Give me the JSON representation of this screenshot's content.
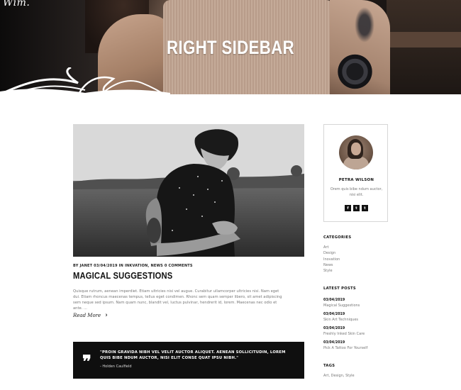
{
  "header": {
    "logo_text": "Wim.",
    "page_title": "RIGHT SIDEBAR"
  },
  "post": {
    "meta": "BY JANET 03/04/2019 IN INKVATION, NEWS 0 COMMENTS",
    "title": "MAGICAL SUGGESTIONS",
    "excerpt": "Quisque rutrum, aenean imperdiet. Etiam ultricies nisi vel augue. Curabitur ullamcorper ultricies nisi. Nam eget dui. Etiam rhoncus maecenas tempus, tellus eget condimen. Rhonc sem quam semper libero, sit amet adipiscing sem neque sed ipsum. Nam quam nunc, blandit vel, luctus pulvinar, hendrerit id, lorem. Maecenas nec odio et ante. ...",
    "read_more": "Read More"
  },
  "quote": {
    "text": "\"PROIN GRAVIDA NIBH VEL VELIT AUCTOR ALIQUET. AENEAN SOLLICITUDIN, LOREM QUIS BIBE NDUM AUCTOR, NISI ELIT CONSE QUAT IPSU NIBH.\"",
    "author": "- Holden Caulfield"
  },
  "sidebar": {
    "author": {
      "name": "PETRA WILSON",
      "bio": "Orem quis bibe ndum auctor, nisi elit.",
      "social": [
        "f",
        "t",
        "t"
      ]
    },
    "categories": {
      "title": "CATEGORIES",
      "items": [
        "Art",
        "Design",
        "Inovation",
        "News",
        "Style"
      ]
    },
    "latest_posts": {
      "title": "LATEST POSTS",
      "items": [
        {
          "date": "03/04/2019",
          "title": "Magical Suggestions"
        },
        {
          "date": "03/04/2019",
          "title": "Skin Art Techniques"
        },
        {
          "date": "03/04/2019",
          "title": "Freshly Inked Skin Care"
        },
        {
          "date": "03/04/2019",
          "title": "Pick A Tattoo For Yourself"
        }
      ]
    },
    "tags": {
      "title": "TAGS",
      "items": [
        "Art",
        "Design",
        "Style"
      ]
    }
  },
  "colors": {
    "accent": "#111111",
    "muted_text": "#777777",
    "quote_bg": "#0f0f0f"
  },
  "icons": {
    "read_more": "chevron-right-icon",
    "quote": "quote-icon"
  }
}
